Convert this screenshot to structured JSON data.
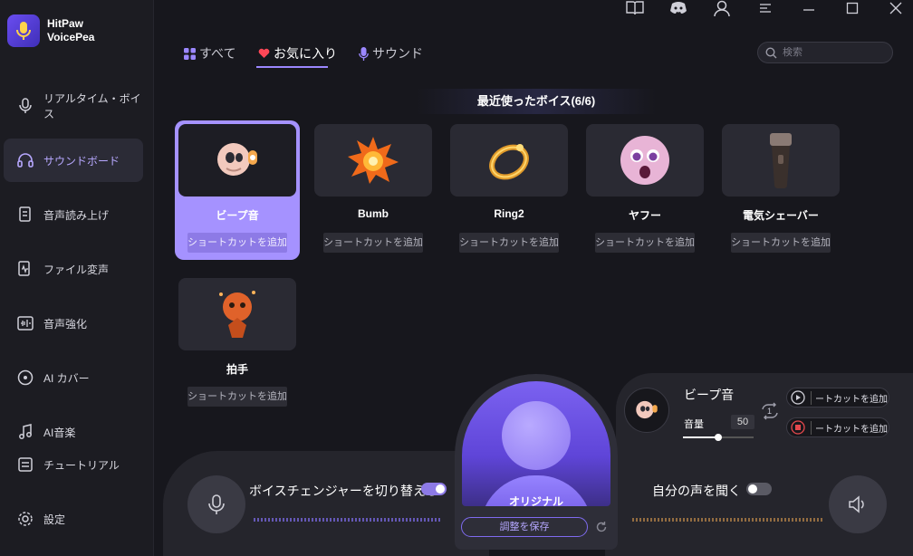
{
  "app": {
    "name_line1": "HitPaw",
    "name_line2": "VoicePea"
  },
  "sidebar": {
    "items": [
      {
        "label": "リアルタイム・ボイス",
        "icon": "mic-wave-icon"
      },
      {
        "label": "サウンドボード",
        "icon": "headphones-icon",
        "active": true
      },
      {
        "label": "音声読み上げ",
        "icon": "document-voice-icon"
      },
      {
        "label": "ファイル変声",
        "icon": "file-wave-icon"
      },
      {
        "label": "音声強化",
        "icon": "enhance-icon"
      },
      {
        "label": "AI カバー",
        "icon": "disc-icon"
      },
      {
        "label": "AI音楽",
        "icon": "music-note-icon"
      },
      {
        "label": "チュートリアル",
        "icon": "tutorial-icon"
      },
      {
        "label": "設定",
        "icon": "gear-icon"
      }
    ]
  },
  "tabs": [
    {
      "label": "すべて",
      "icon": "grid-icon"
    },
    {
      "label": "お気に入り",
      "icon": "heart-icon",
      "active": true
    },
    {
      "label": "サウンド",
      "icon": "mic-icon"
    }
  ],
  "search": {
    "placeholder": "検索"
  },
  "section": {
    "title": "最近使ったボイス(6/6)"
  },
  "cards": [
    {
      "name": "ビープ音",
      "shortcut": "ショートカットを追加",
      "selected": true
    },
    {
      "name": "Bumb",
      "shortcut": "ショートカットを追加"
    },
    {
      "name": "Ring2",
      "shortcut": "ショートカットを追加"
    },
    {
      "name": "ヤフー",
      "shortcut": "ショートカットを追加"
    },
    {
      "name": "電気シェーバー",
      "shortcut": "ショートカットを追加"
    },
    {
      "name": "拍手",
      "shortcut": "ショートカットを追加"
    }
  ],
  "bottom": {
    "toggle_voice_label": "ボイスチェンジャーを切り替える",
    "toggle_voice_on": true,
    "hear_self_label": "自分の声を聞く",
    "hear_self_on": false,
    "center_label": "オリジナル",
    "save_label": "調整を保存"
  },
  "player": {
    "name": "ビープ音",
    "volume_label": "音量",
    "volume_value": "50",
    "loop_count": "1",
    "play_shortcut": "ートカットを追加",
    "stop_shortcut": "ートカットを追加"
  },
  "colors": {
    "accent": "#a592ff",
    "bg": "#17171d",
    "sidebar": "#1c1c22"
  }
}
